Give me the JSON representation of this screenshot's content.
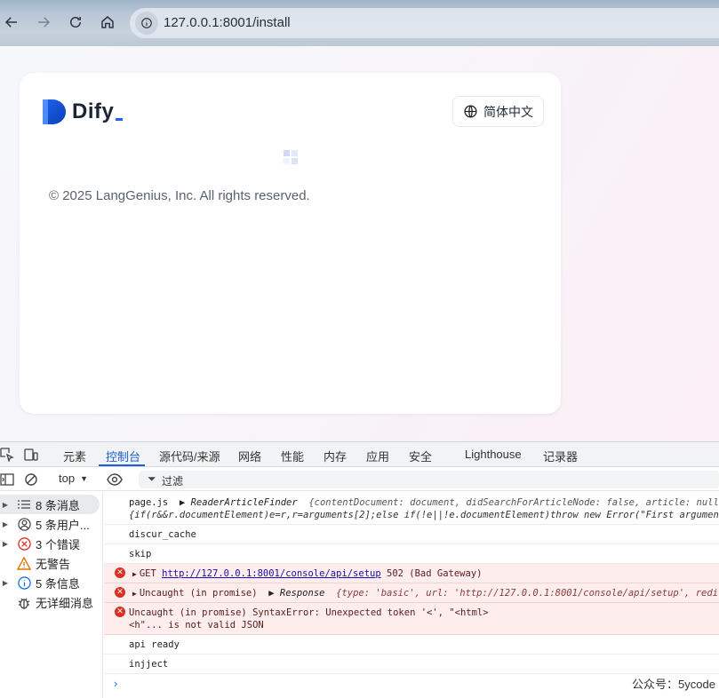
{
  "browser": {
    "url": "127.0.0.1:8001/install",
    "icons": [
      "back-arrow-icon",
      "forward-arrow-icon",
      "reload-icon",
      "home-icon",
      "site-info-icon"
    ]
  },
  "page": {
    "logo_text": "Dify",
    "language_button": "简体中文",
    "copyright": "© 2025 LangGenius, Inc. All rights reserved.",
    "accent_color": "#1c64f2"
  },
  "devtools": {
    "tabs": [
      "元素",
      "控制台",
      "源代码/来源",
      "网络",
      "性能",
      "内存",
      "应用",
      "安全",
      "Lighthouse",
      "记录器"
    ],
    "active_tab": "控制台",
    "toolbar": {
      "context": "top",
      "filter_placeholder": "过滤"
    },
    "sidebar": [
      {
        "label": "8 条消息",
        "icon": "list-icon"
      },
      {
        "label": "5 条用户...",
        "icon": "user-icon"
      },
      {
        "label": "3 个错误",
        "icon": "error-icon"
      },
      {
        "label": "无警告",
        "icon": "warning-icon"
      },
      {
        "label": "5 条信息",
        "icon": "info-icon"
      },
      {
        "label": "无详细消息",
        "icon": "bug-icon"
      }
    ],
    "console": {
      "line1_a": "page.js",
      "line1_b": "▶ ReaderArticleFinder",
      "line1_c": "{contentDocument: document, didSearchForArticleNode: false, article: null, didS",
      "line1_d": "{if(r&&r.documentElement)e=r,r=arguments[2];else if(!e||!e.documentElement)throw new Error(\"First argument to R",
      "line2": "discur_cache",
      "line3": "skip",
      "line4_method": "GET",
      "line4_url": "http://127.0.0.1:8001/console/api/setup",
      "line4_status": "502 (Bad Gateway)",
      "line5_a": "Uncaught (in promise)",
      "line5_b": "▶ Response",
      "line5_c": "{type: 'basic', url: 'http://127.0.0.1:8001/console/api/setup', redirected",
      "line6_a": "Uncaught (in promise) SyntaxError: Unexpected token '<', \"<html>",
      "line6_b": "<h\"... is not valid JSON",
      "line7": "api ready",
      "line8": "injject",
      "prompt": "›"
    }
  },
  "watermark": "公众号：5ycode"
}
